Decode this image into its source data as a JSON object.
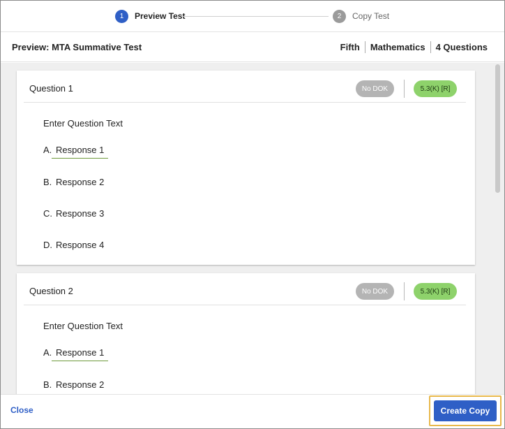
{
  "stepper": {
    "steps": [
      {
        "number": "1",
        "label": "Preview Test",
        "state": "active"
      },
      {
        "number": "2",
        "label": "Copy Test",
        "state": "inactive"
      }
    ]
  },
  "header": {
    "title": "Preview: MTA Summative Test",
    "grade": "Fifth",
    "subject": "Mathematics",
    "question_count": "4 Questions"
  },
  "questions": [
    {
      "title": "Question 1",
      "dok": "No DOK",
      "standard": "5.3(K) [R]",
      "text": "Enter Question Text",
      "responses": [
        {
          "letter": "A.",
          "text": "Response 1",
          "selected": true
        },
        {
          "letter": "B.",
          "text": "Response 2",
          "selected": false
        },
        {
          "letter": "C.",
          "text": "Response 3",
          "selected": false
        },
        {
          "letter": "D.",
          "text": "Response 4",
          "selected": false
        }
      ]
    },
    {
      "title": "Question 2",
      "dok": "No DOK",
      "standard": "5.3(K) [R]",
      "text": "Enter Question Text",
      "responses": [
        {
          "letter": "A.",
          "text": "Response 1",
          "selected": true
        },
        {
          "letter": "B.",
          "text": "Response 2",
          "selected": false
        }
      ]
    }
  ],
  "footer": {
    "close_label": "Close",
    "create_label": "Create Copy"
  },
  "colors": {
    "primary": "#2f5fc6",
    "dok_pill": "#b4b4b4",
    "standard_pill": "#8ed26b",
    "selected_underline": "#6f9a3c",
    "highlight_border": "#e8b84a"
  }
}
